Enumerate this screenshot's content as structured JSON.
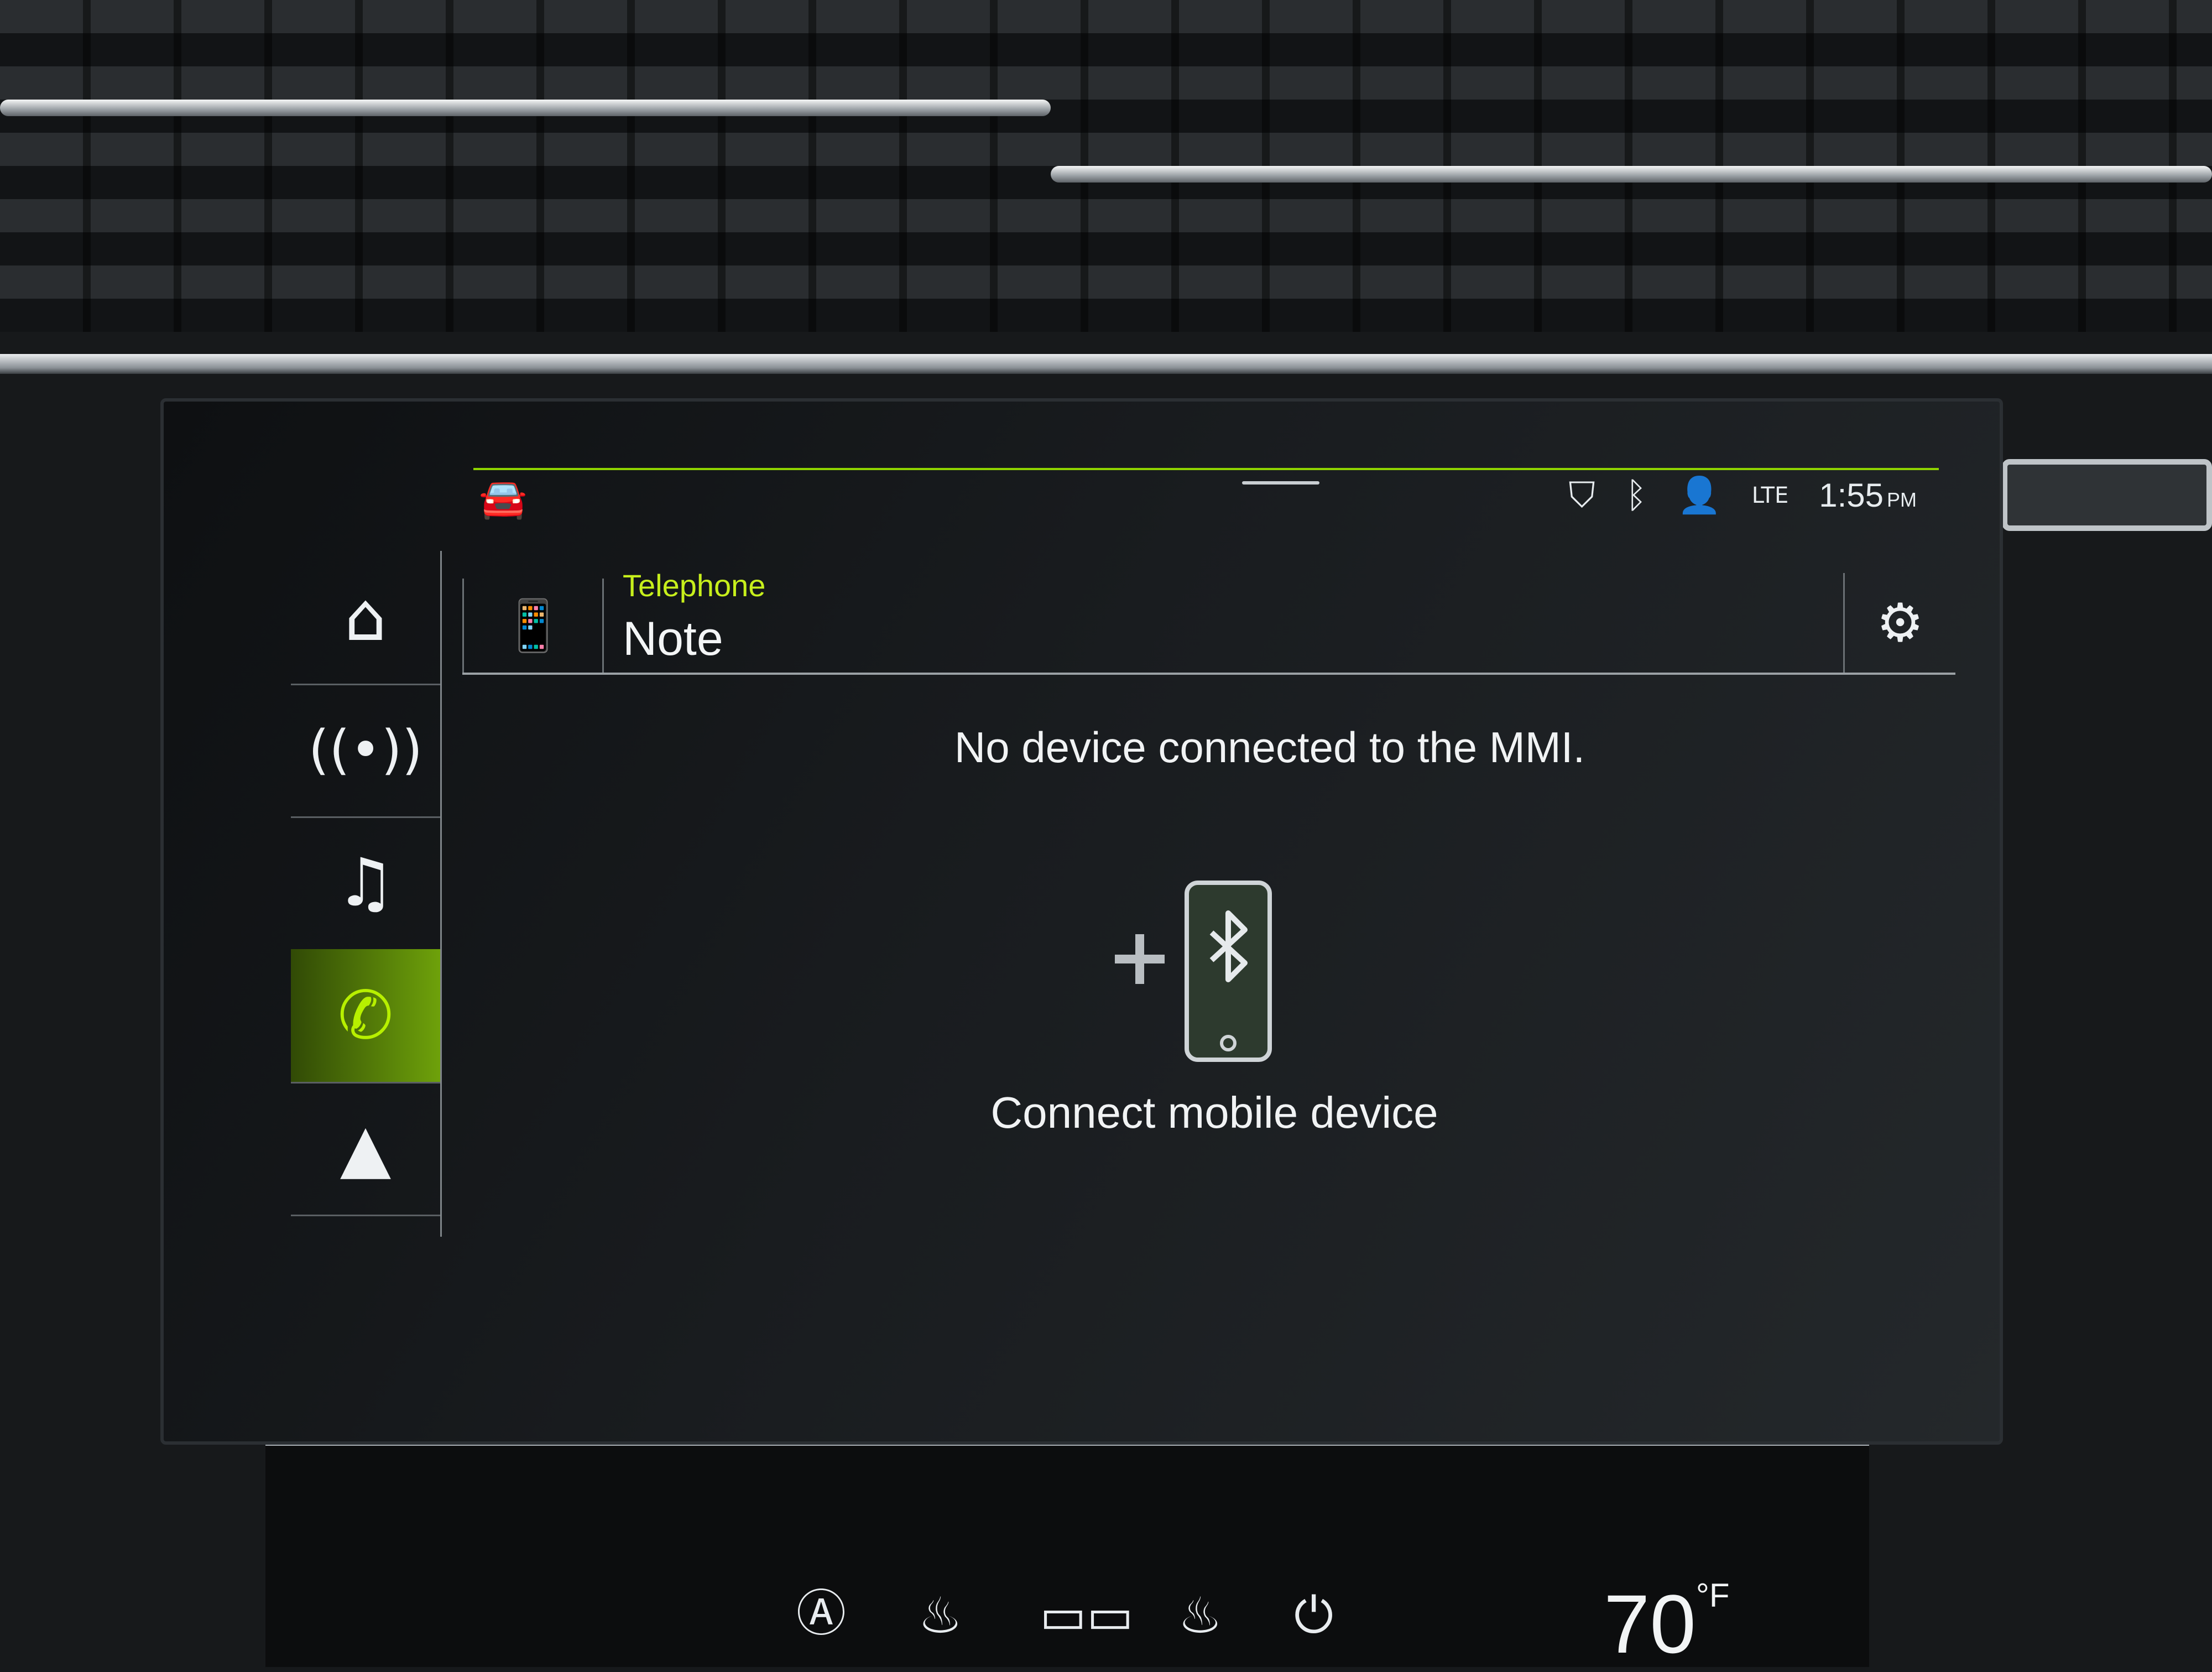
{
  "status_bar": {
    "time": "1:55",
    "ampm": "PM",
    "icons": [
      "car-info-icon",
      "location-shield-icon",
      "bluetooth-icon",
      "person-info-icon",
      "lte-signal-icon"
    ]
  },
  "side_nav": {
    "items": [
      {
        "name": "home",
        "icon": "home-icon"
      },
      {
        "name": "radio",
        "icon": "antenna-icon"
      },
      {
        "name": "media",
        "icon": "music-icon"
      },
      {
        "name": "telephone",
        "icon": "phone-icon",
        "active": true
      },
      {
        "name": "navigation",
        "icon": "navigation-arrow-icon"
      }
    ]
  },
  "header": {
    "app": "Telephone",
    "title": "Note"
  },
  "main": {
    "message": "No device connected to the MMI.",
    "connect_label": "Connect mobile device"
  },
  "climate": {
    "temperature": "70",
    "unit": "°F"
  },
  "colors": {
    "accent": "#b7f000",
    "screen_bg": "#1b1e21",
    "text": "#f1f3f4"
  }
}
